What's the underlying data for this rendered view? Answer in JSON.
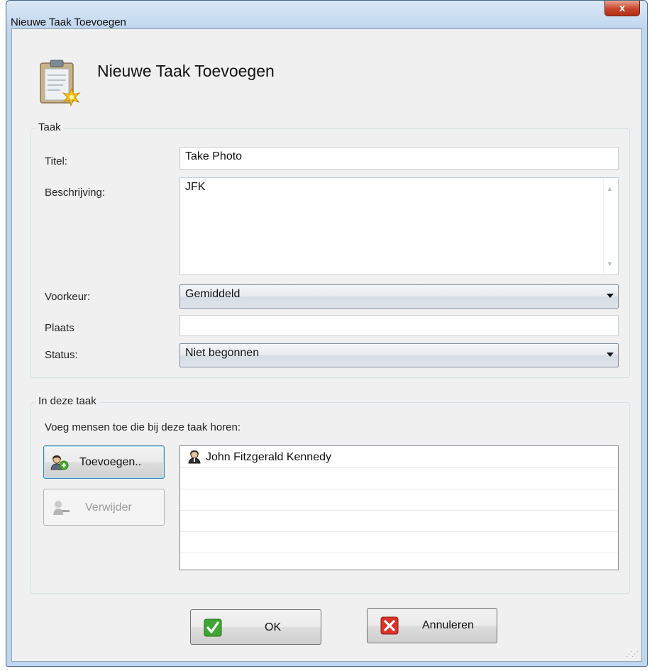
{
  "window": {
    "title": "Nieuwe Taak Toevoegen",
    "close_glyph": "x"
  },
  "header": {
    "title": "Nieuwe Taak Toevoegen",
    "icon": "clipboard-star-icon"
  },
  "task_group": {
    "label": "Taak",
    "title_label": "Titel:",
    "title_value": "Take Photo",
    "description_label": "Beschrijving:",
    "description_value": "JFK",
    "preference_label": "Voorkeur:",
    "preference_value": "Gemiddeld",
    "place_label": "Plaats",
    "place_value": "",
    "status_label": "Status:",
    "status_value": "Niet begonnen"
  },
  "people_group": {
    "label": "In deze taak",
    "instruction": "Voeg mensen toe die bij deze taak horen:",
    "add_button": "Toevoegen..",
    "remove_button": "Verwijder",
    "people": [
      {
        "name": "John Fitzgerald Kennedy",
        "icon": "person-icon"
      }
    ]
  },
  "footer": {
    "ok_button": "OK",
    "cancel_button": "Annuleren"
  },
  "colors": {
    "ok_green": "#3fa535",
    "cancel_red": "#d9342b",
    "add_green": "#4caf2a"
  }
}
